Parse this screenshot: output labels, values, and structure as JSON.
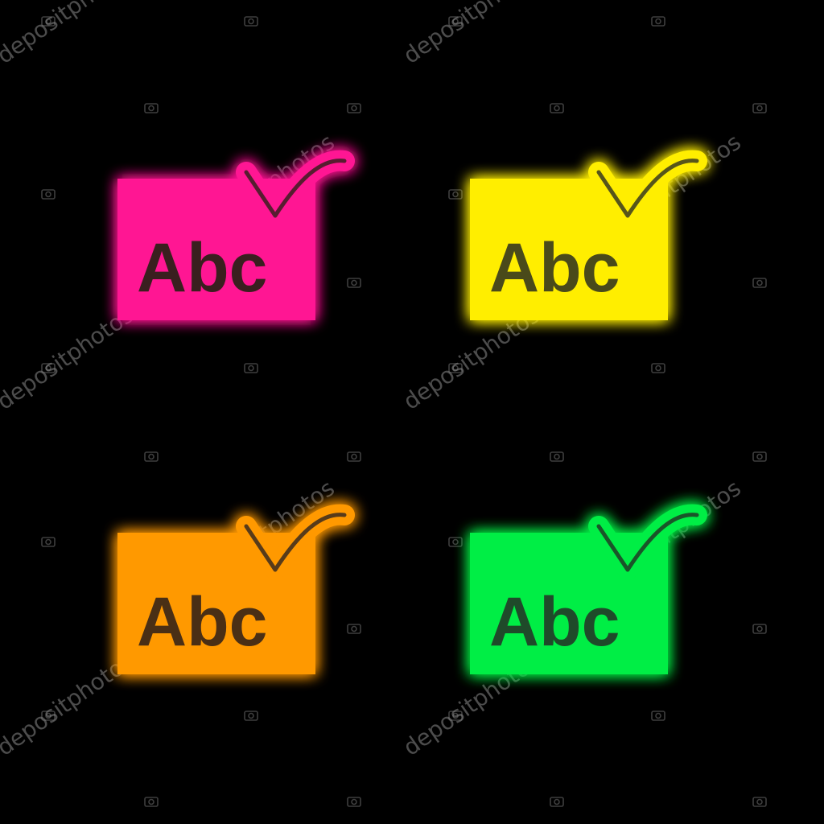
{
  "background": "#000000",
  "text_color": "#3a1f1f",
  "icons": [
    {
      "name": "pink",
      "color": "#ff1493",
      "glow": "#ff2aa0",
      "label": "Abc"
    },
    {
      "name": "yellow",
      "color": "#ffee00",
      "glow": "#fff34d",
      "label": "Abc"
    },
    {
      "name": "orange",
      "color": "#ff9900",
      "glow": "#ffad33",
      "label": "Abc"
    },
    {
      "name": "green",
      "color": "#00ee44",
      "glow": "#33ff66",
      "label": "Abc"
    }
  ],
  "watermark": {
    "text": "depositphotos",
    "icon": "camera-icon"
  }
}
